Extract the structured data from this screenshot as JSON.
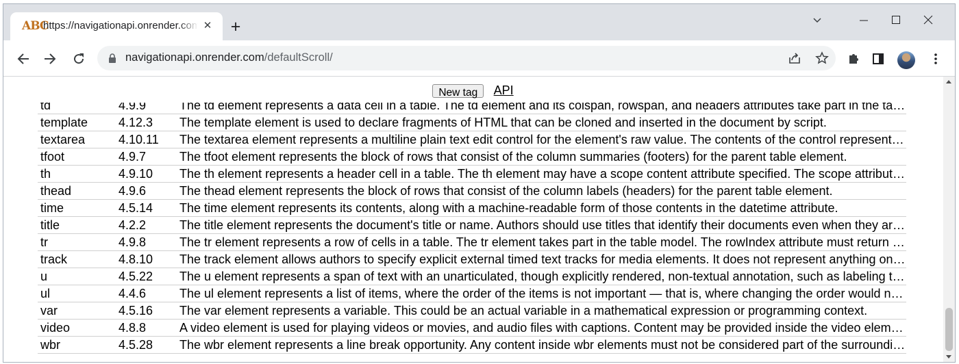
{
  "browser": {
    "tab_title": "https://navigationapi.onrender.com/defaultScroll/",
    "favicon_text": "ABC",
    "address_host": "navigationapi.onrender.com",
    "address_path": "/defaultScroll/"
  },
  "page": {
    "new_tag_label": "New tag",
    "api_label": "API",
    "rows": [
      {
        "tag": "td",
        "section": "4.9.9",
        "desc": "The td element represents a data cell in a table. The td element and its colspan, rowspan, and headers attributes take part in the table model."
      },
      {
        "tag": "template",
        "section": "4.12.3",
        "desc": "The template element is used to declare fragments of HTML that can be cloned and inserted in the document by script."
      },
      {
        "tag": "textarea",
        "section": "4.10.11",
        "desc": "The textarea element represents a multiline plain text edit control for the element's raw value. The contents of the control represent the control's default value."
      },
      {
        "tag": "tfoot",
        "section": "4.9.7",
        "desc": "The tfoot element represents the block of rows that consist of the column summaries (footers) for the parent table element."
      },
      {
        "tag": "th",
        "section": "4.9.10",
        "desc": "The th element represents a header cell in a table. The th element may have a scope content attribute specified. The scope attribute is an enumerated attribute."
      },
      {
        "tag": "thead",
        "section": "4.9.6",
        "desc": "The thead element represents the block of rows that consist of the column labels (headers) for the parent table element."
      },
      {
        "tag": "time",
        "section": "4.5.14",
        "desc": "The time element represents its contents, along with a machine-readable form of those contents in the datetime attribute."
      },
      {
        "tag": "title",
        "section": "4.2.2",
        "desc": "The title element represents the document's title or name. Authors should use titles that identify their documents even when they are used out of context."
      },
      {
        "tag": "tr",
        "section": "4.9.8",
        "desc": "The tr element represents a row of cells in a table. The tr element takes part in the table model. The rowIndex attribute must return the index of the row."
      },
      {
        "tag": "track",
        "section": "4.8.10",
        "desc": "The track element allows authors to specify explicit external timed text tracks for media elements. It does not represent anything on its own."
      },
      {
        "tag": "u",
        "section": "4.5.22",
        "desc": "The u element represents a span of text with an unarticulated, though explicitly rendered, non-textual annotation, such as labeling the text as being a proper name."
      },
      {
        "tag": "ul",
        "section": "4.4.6",
        "desc": "The ul element represents a list of items, where the order of the items is not important — that is, where changing the order would not materially change the meaning."
      },
      {
        "tag": "var",
        "section": "4.5.16",
        "desc": "The var element represents a variable. This could be an actual variable in a mathematical expression or programming context."
      },
      {
        "tag": "video",
        "section": "4.8.8",
        "desc": "A video element is used for playing videos or movies, and audio files with captions. Content may be provided inside the video element."
      },
      {
        "tag": "wbr",
        "section": "4.5.28",
        "desc": "The wbr element represents a line break opportunity. Any content inside wbr elements must not be considered part of the surrounding text."
      }
    ]
  }
}
